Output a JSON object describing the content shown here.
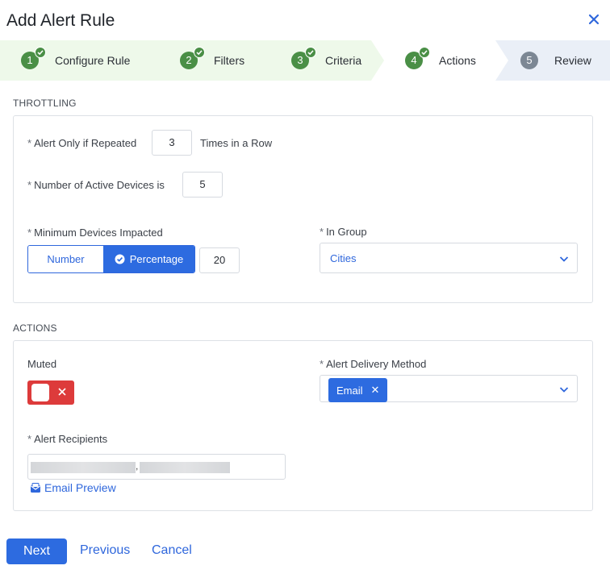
{
  "dialog": {
    "title": "Add Alert Rule"
  },
  "stepper": {
    "steps": [
      {
        "number": "1",
        "label": "Configure Rule",
        "status": "complete"
      },
      {
        "number": "2",
        "label": "Filters",
        "status": "complete"
      },
      {
        "number": "3",
        "label": "Criteria",
        "status": "complete"
      },
      {
        "number": "4",
        "label": "Actions",
        "status": "current"
      },
      {
        "number": "5",
        "label": "Review",
        "status": "pending"
      }
    ]
  },
  "throttling": {
    "section_title": "THROTTLING",
    "repeated": {
      "label": "Alert Only if Repeated",
      "value": "3",
      "suffix": "Times in a Row"
    },
    "active_devices": {
      "label": "Number of Active Devices is",
      "value": "5"
    },
    "min_devices": {
      "label": "Minimum Devices Impacted",
      "options": [
        "Number",
        "Percentage"
      ],
      "selected": "Percentage",
      "value": "20"
    },
    "in_group": {
      "label": "In Group",
      "value": "Cities"
    }
  },
  "actions": {
    "section_title": "ACTIONS",
    "muted": {
      "label": "Muted",
      "on": true
    },
    "delivery": {
      "label": "Alert Delivery Method",
      "chips": [
        "Email"
      ]
    },
    "recipients": {
      "label": "Alert Recipients",
      "separator": ","
    },
    "email_preview": "Email Preview"
  },
  "footer": {
    "next_label": "Next",
    "previous_label": "Previous",
    "cancel_label": "Cancel"
  },
  "colors": {
    "accent": "#2d6be0",
    "step_complete": "#4a8f46",
    "step_complete_bg": "#eef9ea",
    "step_current_bg": "#ffffff",
    "step_pending_bg": "#eaeff7",
    "toggle_on": "#dd3b3b"
  }
}
